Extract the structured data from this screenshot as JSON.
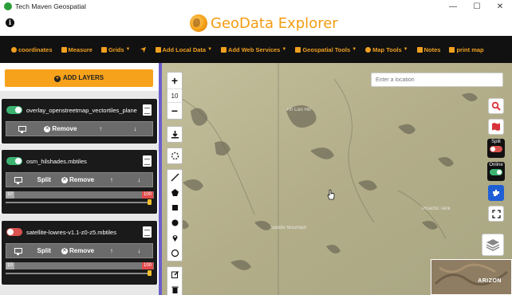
{
  "window": {
    "title": "Tech Maven Geospatial",
    "controls": {
      "minimize": "—",
      "maximize": "☐",
      "close": "✕"
    }
  },
  "header": {
    "info_glyph": "i",
    "brand": "GeoData Explorer",
    "brand_color": "#f39c12"
  },
  "menu": {
    "items": [
      {
        "label": "coordinates",
        "icon": "globe-icon",
        "dropdown": false
      },
      {
        "label": "Measure",
        "icon": "edit-icon",
        "dropdown": false
      },
      {
        "label": "Grids",
        "icon": "grid-icon",
        "dropdown": true
      },
      {
        "label": "",
        "icon": "location-arrow-icon",
        "dropdown": false
      },
      {
        "label": "Add Local Data",
        "icon": "folder-icon",
        "dropdown": true
      },
      {
        "label": "Add Web Services",
        "icon": "web-icon",
        "dropdown": true
      },
      {
        "label": "Geospatial Tools",
        "icon": "tools-icon",
        "dropdown": true
      },
      {
        "label": "Map Tools",
        "icon": "cog-icon",
        "dropdown": true
      },
      {
        "label": "Notes",
        "icon": "notes-icon",
        "dropdown": false
      },
      {
        "label": "print map",
        "icon": "print-icon",
        "dropdown": false
      }
    ],
    "accent": "#f0a020"
  },
  "sidebar": {
    "add_layers_label": "ADD LAYERS",
    "layers": [
      {
        "name": "overlay_openstreetmap_vectortiles_plane",
        "on": true,
        "split": false,
        "remove": "Remove",
        "has_opacity": false
      },
      {
        "name": "osm_hilshades.mbtiles",
        "on": true,
        "split": true,
        "split_label": "Split",
        "remove": "Remove",
        "has_opacity": true,
        "opacity_min": "10",
        "opacity_max": "100",
        "opacity_value": 1.0
      },
      {
        "name": "satellite-lowres-v1.1-z0-z5.mbtiles",
        "on": false,
        "split": true,
        "split_label": "Split",
        "remove": "Remove",
        "has_opacity": true,
        "opacity_min": "10",
        "opacity_max": "100",
        "opacity_value": 1.0
      }
    ]
  },
  "map": {
    "zoom_in": "+",
    "zoom_level": "10",
    "zoom_out": "−",
    "search_placeholder": "Enter a location",
    "split_label": "Split",
    "online_label": "Online",
    "minimap_label": "ARIZON",
    "labels": [
      "Tin Can Hill",
      "Saddle Mountain",
      "Picacho Tank"
    ]
  }
}
